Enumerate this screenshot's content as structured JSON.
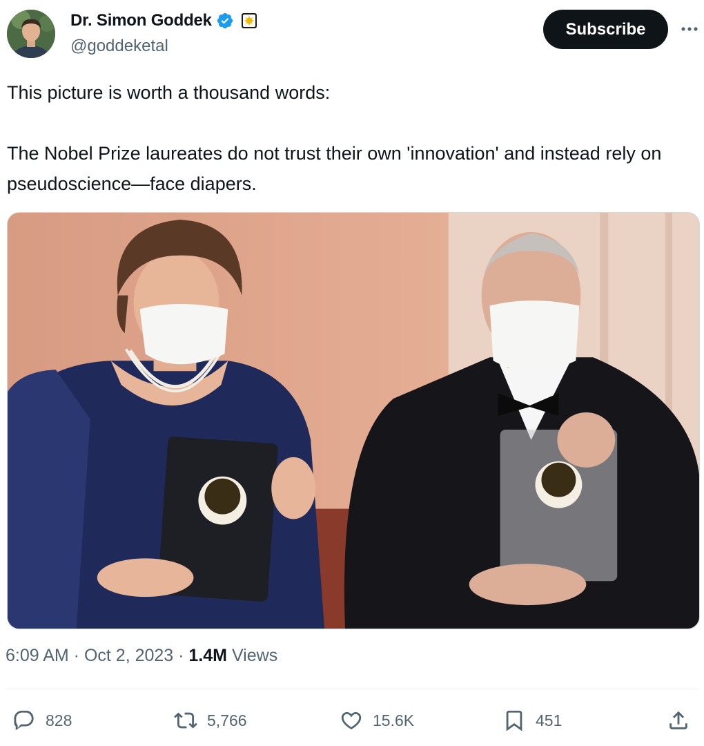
{
  "author": {
    "display_name": "Dr. Simon Goddek",
    "handle": "@goddeketal",
    "verified_color": "#1d9bf0",
    "affiliate_badge_color": "#f5c518"
  },
  "header": {
    "subscribe_label": "Subscribe",
    "more_icon": "more-horizontal-icon"
  },
  "tweet": {
    "paragraphs": [
      "This picture is worth a thousand words:",
      "The Nobel Prize laureates do not trust their own 'innovation' and instead rely on pseudoscience—face diapers."
    ]
  },
  "meta": {
    "time": "6:09 AM",
    "separator": " · ",
    "date": "Oct 2, 2023",
    "views_count": "1.4M",
    "views_label": " Views"
  },
  "actions": {
    "replies": "828",
    "reposts": "5,766",
    "likes": "15.6K",
    "bookmarks": "451"
  },
  "colors": {
    "text": "#0f1419",
    "secondary": "#536471",
    "border": "#cfd9de"
  }
}
